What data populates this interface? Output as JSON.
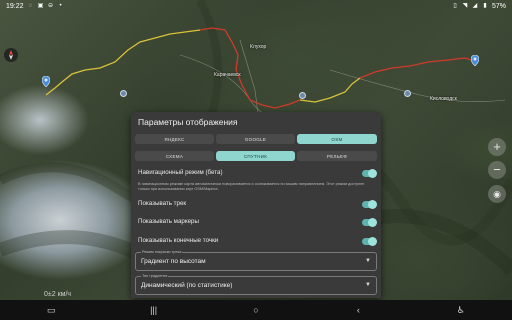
{
  "statusbar": {
    "time": "19:22",
    "battery": "57%",
    "icons_left": [
      "gps-icon",
      "photo-icon",
      "dnd-icon",
      "location-icon"
    ],
    "icons_right": [
      "vibrate-icon",
      "wifi-icon",
      "signal-icon",
      "battery-icon"
    ]
  },
  "map": {
    "labels": [
      {
        "text": "Клухор",
        "pos": "right"
      },
      {
        "text": "Карачаевск",
        "pos": "center"
      },
      {
        "text": "Кисловодск",
        "pos": "right"
      }
    ],
    "speed_text": "0±2 км/ч"
  },
  "dialog": {
    "title": "Параметры отображения",
    "provider_tabs": [
      {
        "label": "ЯНДЕКС",
        "selected": false
      },
      {
        "label": "GOOGLE",
        "selected": false
      },
      {
        "label": "OSM",
        "selected": true
      }
    ],
    "layer_tabs": [
      {
        "label": "СХЕМА",
        "selected": false
      },
      {
        "label": "СПУТНИК",
        "selected": true
      },
      {
        "label": "РЕЛЬЕФ",
        "selected": false
      }
    ],
    "nav_mode_label": "Навигационный режим (бета)",
    "nav_mode_desc": "В навигационном режиме карта автоматически поворачивается и ослеживается по вашим направлением. Этот режим доступен только при использовании карт OSM/Mapbox.",
    "show_track_label": "Показывать трек",
    "show_markers_label": "Показывать маркеры",
    "show_endpoints_label": "Показывать конечные точки",
    "coloring_mode": {
      "caption": "Режим покраски трека",
      "value": "Градиент по высотам"
    },
    "gradient_type": {
      "caption": "Тип градиента",
      "value": "Динамический (по статистике)"
    }
  },
  "map_controls": {
    "zoom_in": "+",
    "zoom_out": "−"
  },
  "colors": {
    "accent": "#8fd6cf",
    "switch": "#5fb3ac",
    "dialog_bg": "#3a3a3a",
    "track_red": "#d03a2a",
    "track_yellow": "#d9c23a"
  }
}
